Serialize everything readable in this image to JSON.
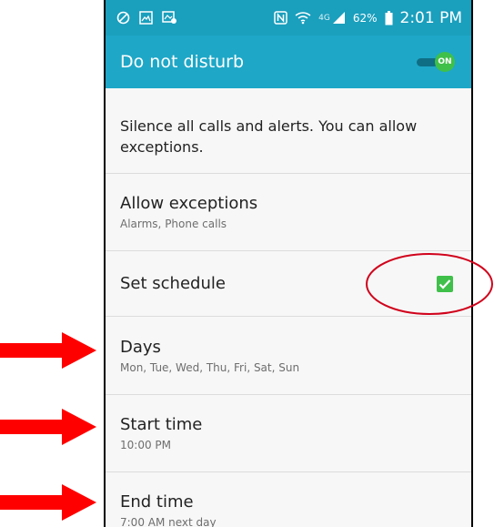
{
  "status_bar": {
    "battery_percent": "62%",
    "network": "4G",
    "time": "2:01 PM",
    "icons": [
      "block-icon",
      "image-icon",
      "media-icon",
      "nfc-icon",
      "wifi-icon",
      "signal-icon",
      "battery-icon"
    ]
  },
  "header": {
    "title": "Do not disturb",
    "toggle_label": "ON",
    "toggle_state": "on"
  },
  "description": "Silence all calls and alerts. You can allow exceptions.",
  "rows": {
    "exceptions": {
      "title": "Allow exceptions",
      "subtitle": "Alarms, Phone calls"
    },
    "schedule": {
      "title": "Set schedule",
      "checked": true
    },
    "days": {
      "title": "Days",
      "subtitle": "Mon, Tue, Wed, Thu, Fri, Sat, Sun"
    },
    "start": {
      "title": "Start time",
      "subtitle": "10:00 PM"
    },
    "end": {
      "title": "End time",
      "subtitle": "7:00 AM next day"
    }
  },
  "annotations": {
    "circle_color": "#d0021b",
    "arrow_color": "#ff0000",
    "arrow_targets": [
      "Days",
      "Start time",
      "End time"
    ]
  },
  "colors": {
    "status_bar": "#1a9fbd",
    "action_bar": "#1ea7c7",
    "accent_green": "#3fc04a"
  }
}
